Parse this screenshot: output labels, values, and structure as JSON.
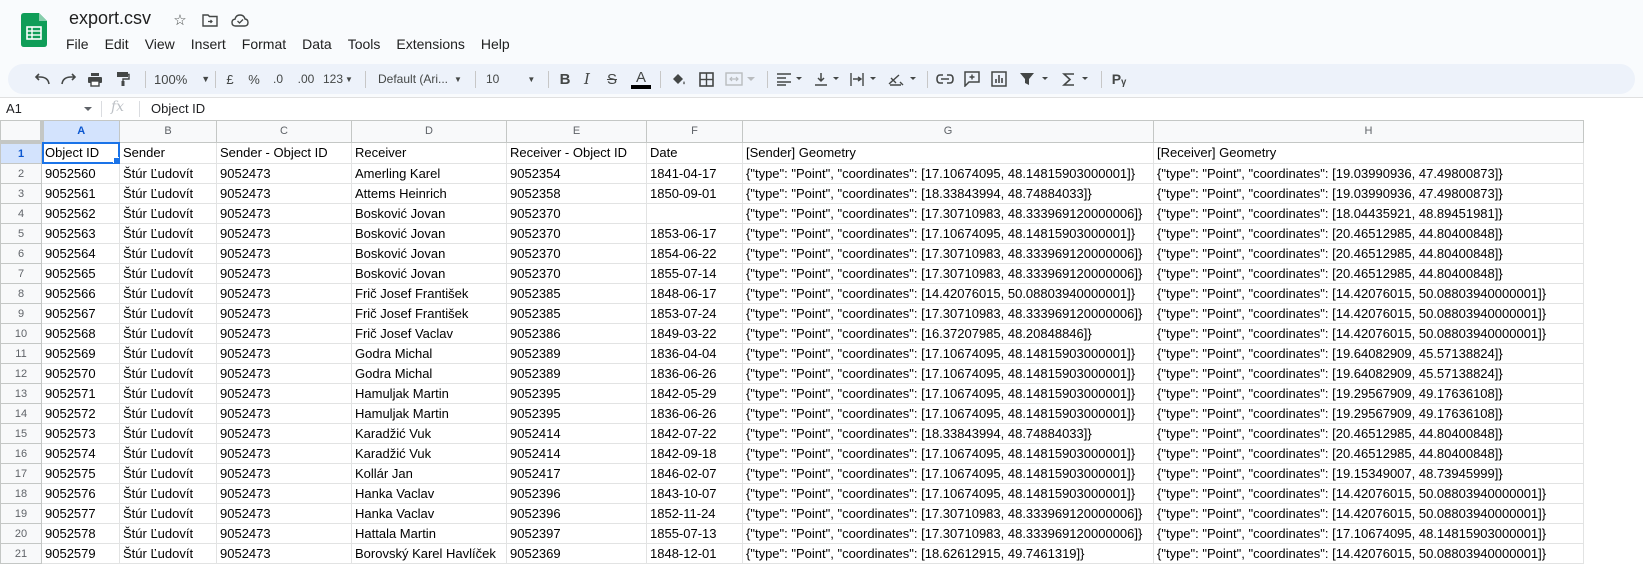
{
  "app": {
    "doc_title": "export.csv"
  },
  "title_icons": [
    "star-icon",
    "move-to-folder-icon",
    "cloud-status-icon"
  ],
  "menu": [
    "File",
    "Edit",
    "View",
    "Insert",
    "Format",
    "Data",
    "Tools",
    "Extensions",
    "Help"
  ],
  "toolbar": {
    "zoom": "100%",
    "currency": "£",
    "percent": "%",
    "dec_decrease": ".0",
    "dec_increase": ".00",
    "more_formats": "123",
    "font": "Default (Ari...",
    "font_size": "10",
    "bold": "B",
    "italic": "I",
    "strike": "S",
    "text_color": "A",
    "special": "Pᵧ"
  },
  "formula_bar": {
    "name_box": "A1",
    "fx": "fx",
    "content": "Object ID"
  },
  "grid": {
    "columns": [
      "A",
      "B",
      "C",
      "D",
      "E",
      "F",
      "G",
      "H"
    ],
    "rows": [
      [
        "1",
        "Object ID",
        "Sender",
        "Sender - Object ID",
        "Receiver",
        "Receiver - Object ID",
        "Date",
        "[Sender] Geometry",
        "[Receiver] Geometry"
      ],
      [
        "2",
        "9052560",
        "Štúr Ľudovít",
        "9052473",
        "Amerling Karel",
        "9052354",
        "1841-04-17",
        "{\"type\": \"Point\", \"coordinates\": [17.10674095, 48.14815903000001]}",
        "{\"type\": \"Point\", \"coordinates\": [19.03990936, 47.49800873]}"
      ],
      [
        "3",
        "9052561",
        "Štúr Ľudovít",
        "9052473",
        "Attems Heinrich",
        "9052358",
        "1850-09-01",
        "{\"type\": \"Point\", \"coordinates\": [18.33843994, 48.74884033]}",
        "{\"type\": \"Point\", \"coordinates\": [19.03990936, 47.49800873]}"
      ],
      [
        "4",
        "9052562",
        "Štúr Ľudovít",
        "9052473",
        "Bosković Jovan",
        "9052370",
        "",
        "{\"type\": \"Point\", \"coordinates\": [17.30710983, 48.333969120000006]}",
        "{\"type\": \"Point\", \"coordinates\": [18.04435921, 48.89451981]}"
      ],
      [
        "5",
        "9052563",
        "Štúr Ľudovít",
        "9052473",
        "Bosković Jovan",
        "9052370",
        "1853-06-17",
        "{\"type\": \"Point\", \"coordinates\": [17.10674095, 48.14815903000001]}",
        "{\"type\": \"Point\", \"coordinates\": [20.46512985, 44.80400848]}"
      ],
      [
        "6",
        "9052564",
        "Štúr Ľudovít",
        "9052473",
        "Bosković Jovan",
        "9052370",
        "1854-06-22",
        "{\"type\": \"Point\", \"coordinates\": [17.30710983, 48.333969120000006]}",
        "{\"type\": \"Point\", \"coordinates\": [20.46512985, 44.80400848]}"
      ],
      [
        "7",
        "9052565",
        "Štúr Ľudovít",
        "9052473",
        "Bosković Jovan",
        "9052370",
        "1855-07-14",
        "{\"type\": \"Point\", \"coordinates\": [17.30710983, 48.333969120000006]}",
        "{\"type\": \"Point\", \"coordinates\": [20.46512985, 44.80400848]}"
      ],
      [
        "8",
        "9052566",
        "Štúr Ľudovít",
        "9052473",
        "Frič Josef František",
        "9052385",
        "1848-06-17",
        "{\"type\": \"Point\", \"coordinates\": [14.42076015, 50.08803940000001]}",
        "{\"type\": \"Point\", \"coordinates\": [14.42076015, 50.08803940000001]}"
      ],
      [
        "9",
        "9052567",
        "Štúr Ľudovít",
        "9052473",
        "Frič Josef František",
        "9052385",
        "1853-07-24",
        "{\"type\": \"Point\", \"coordinates\": [17.30710983, 48.333969120000006]}",
        "{\"type\": \"Point\", \"coordinates\": [14.42076015, 50.08803940000001]}"
      ],
      [
        "10",
        "9052568",
        "Štúr Ľudovít",
        "9052473",
        "Frič Josef Vaclav",
        "9052386",
        "1849-03-22",
        "{\"type\": \"Point\", \"coordinates\": [16.37207985, 48.20848846]}",
        "{\"type\": \"Point\", \"coordinates\": [14.42076015, 50.08803940000001]}"
      ],
      [
        "11",
        "9052569",
        "Štúr Ľudovít",
        "9052473",
        "Godra Michal",
        "9052389",
        "1836-04-04",
        "{\"type\": \"Point\", \"coordinates\": [17.10674095, 48.14815903000001]}",
        "{\"type\": \"Point\", \"coordinates\": [19.64082909, 45.57138824]}"
      ],
      [
        "12",
        "9052570",
        "Štúr Ľudovít",
        "9052473",
        "Godra Michal",
        "9052389",
        "1836-06-26",
        "{\"type\": \"Point\", \"coordinates\": [17.10674095, 48.14815903000001]}",
        "{\"type\": \"Point\", \"coordinates\": [19.64082909, 45.57138824]}"
      ],
      [
        "13",
        "9052571",
        "Štúr Ľudovít",
        "9052473",
        "Hamuljak Martin",
        "9052395",
        "1842-05-29",
        "{\"type\": \"Point\", \"coordinates\": [17.10674095, 48.14815903000001]}",
        "{\"type\": \"Point\", \"coordinates\": [19.29567909, 49.17636108]}"
      ],
      [
        "14",
        "9052572",
        "Štúr Ľudovít",
        "9052473",
        "Hamuljak Martin",
        "9052395",
        "1836-06-26",
        "{\"type\": \"Point\", \"coordinates\": [17.10674095, 48.14815903000001]}",
        "{\"type\": \"Point\", \"coordinates\": [19.29567909, 49.17636108]}"
      ],
      [
        "15",
        "9052573",
        "Štúr Ľudovít",
        "9052473",
        "Karadžić Vuk",
        "9052414",
        "1842-07-22",
        "{\"type\": \"Point\", \"coordinates\": [18.33843994, 48.74884033]}",
        "{\"type\": \"Point\", \"coordinates\": [20.46512985, 44.80400848]}"
      ],
      [
        "16",
        "9052574",
        "Štúr Ľudovít",
        "9052473",
        "Karadžić Vuk",
        "9052414",
        "1842-09-18",
        "{\"type\": \"Point\", \"coordinates\": [17.10674095, 48.14815903000001]}",
        "{\"type\": \"Point\", \"coordinates\": [20.46512985, 44.80400848]}"
      ],
      [
        "17",
        "9052575",
        "Štúr Ľudovít",
        "9052473",
        "Kollár Jan",
        "9052417",
        "1846-02-07",
        "{\"type\": \"Point\", \"coordinates\": [17.10674095, 48.14815903000001]}",
        "{\"type\": \"Point\", \"coordinates\": [19.15349007, 48.73945999]}"
      ],
      [
        "18",
        "9052576",
        "Štúr Ľudovít",
        "9052473",
        "Hanka Vaclav",
        "9052396",
        "1843-10-07",
        "{\"type\": \"Point\", \"coordinates\": [17.10674095, 48.14815903000001]}",
        "{\"type\": \"Point\", \"coordinates\": [14.42076015, 50.08803940000001]}"
      ],
      [
        "19",
        "9052577",
        "Štúr Ľudovít",
        "9052473",
        "Hanka Vaclav",
        "9052396",
        "1852-11-24",
        "{\"type\": \"Point\", \"coordinates\": [17.30710983, 48.333969120000006]}",
        "{\"type\": \"Point\", \"coordinates\": [14.42076015, 50.08803940000001]}"
      ],
      [
        "20",
        "9052578",
        "Štúr Ľudovít",
        "9052473",
        "Hattala Martin",
        "9052397",
        "1855-07-13",
        "{\"type\": \"Point\", \"coordinates\": [17.30710983, 48.333969120000006]}",
        "{\"type\": \"Point\", \"coordinates\": [17.10674095, 48.14815903000001]}"
      ],
      [
        "21",
        "9052579",
        "Štúr Ľudovít",
        "9052473",
        "Borovský Karel Havlíček",
        "9052369",
        "1848-12-01",
        "{\"type\": \"Point\", \"coordinates\": [18.62612915, 49.7461319]}",
        "{\"type\": \"Point\", \"coordinates\": [14.42076015, 50.08803940000001]}"
      ]
    ]
  }
}
